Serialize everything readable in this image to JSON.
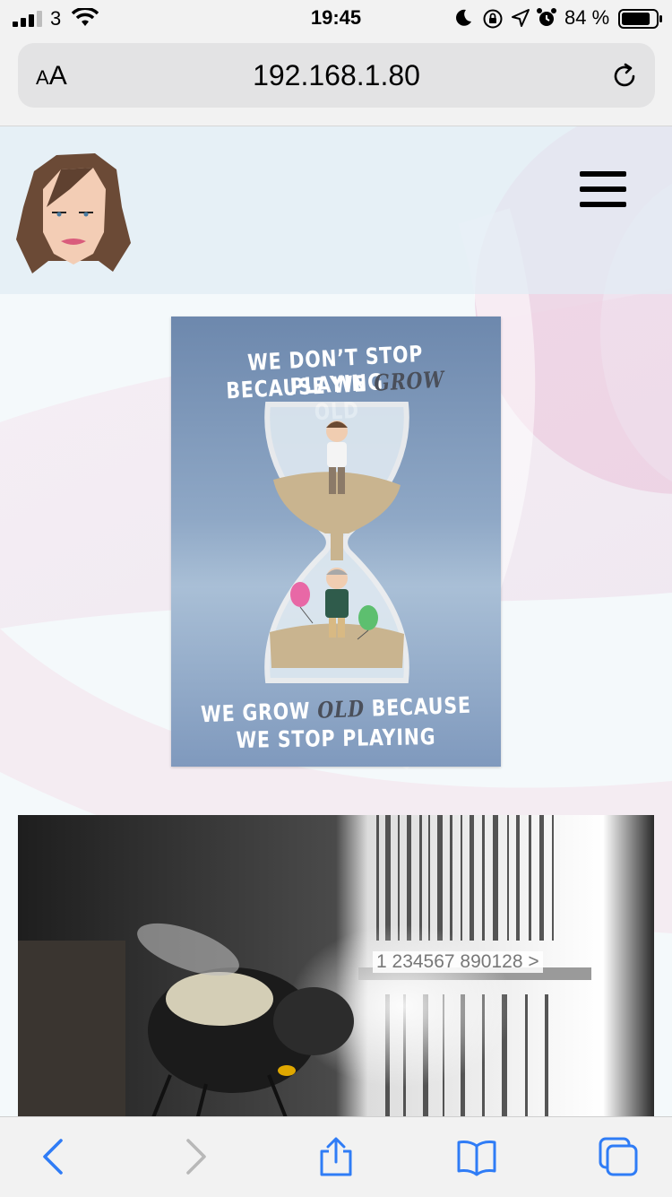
{
  "status_bar": {
    "carrier": "3",
    "time": "19:45",
    "battery_percent": "84 %",
    "battery_level": 0.84
  },
  "browser": {
    "text_size_label_small": "A",
    "text_size_label_large": "A",
    "url": "192.168.1.80"
  },
  "poster": {
    "line1": "WE DON’T STOP PLAYING",
    "line2_a": "BECAUSE WE ",
    "line2_b": "GROW",
    "line2_c": " OLD",
    "line3_a": "WE GROW ",
    "line3_b": "OLD",
    "line3_c": " BECAUSE",
    "line4": "WE STOP PLAYING"
  },
  "bee_photo": {
    "barcode_text": "1  234567  890128  >"
  },
  "colors": {
    "ios_blue": "#2f7cf6",
    "disabled_gray": "#b8b8b8"
  },
  "icons": {
    "back": "chevron-left-icon",
    "forward": "chevron-right-icon",
    "share": "share-icon",
    "bookmarks": "book-icon",
    "tabs": "tabs-icon",
    "reload": "reload-icon",
    "menu": "hamburger-icon"
  }
}
